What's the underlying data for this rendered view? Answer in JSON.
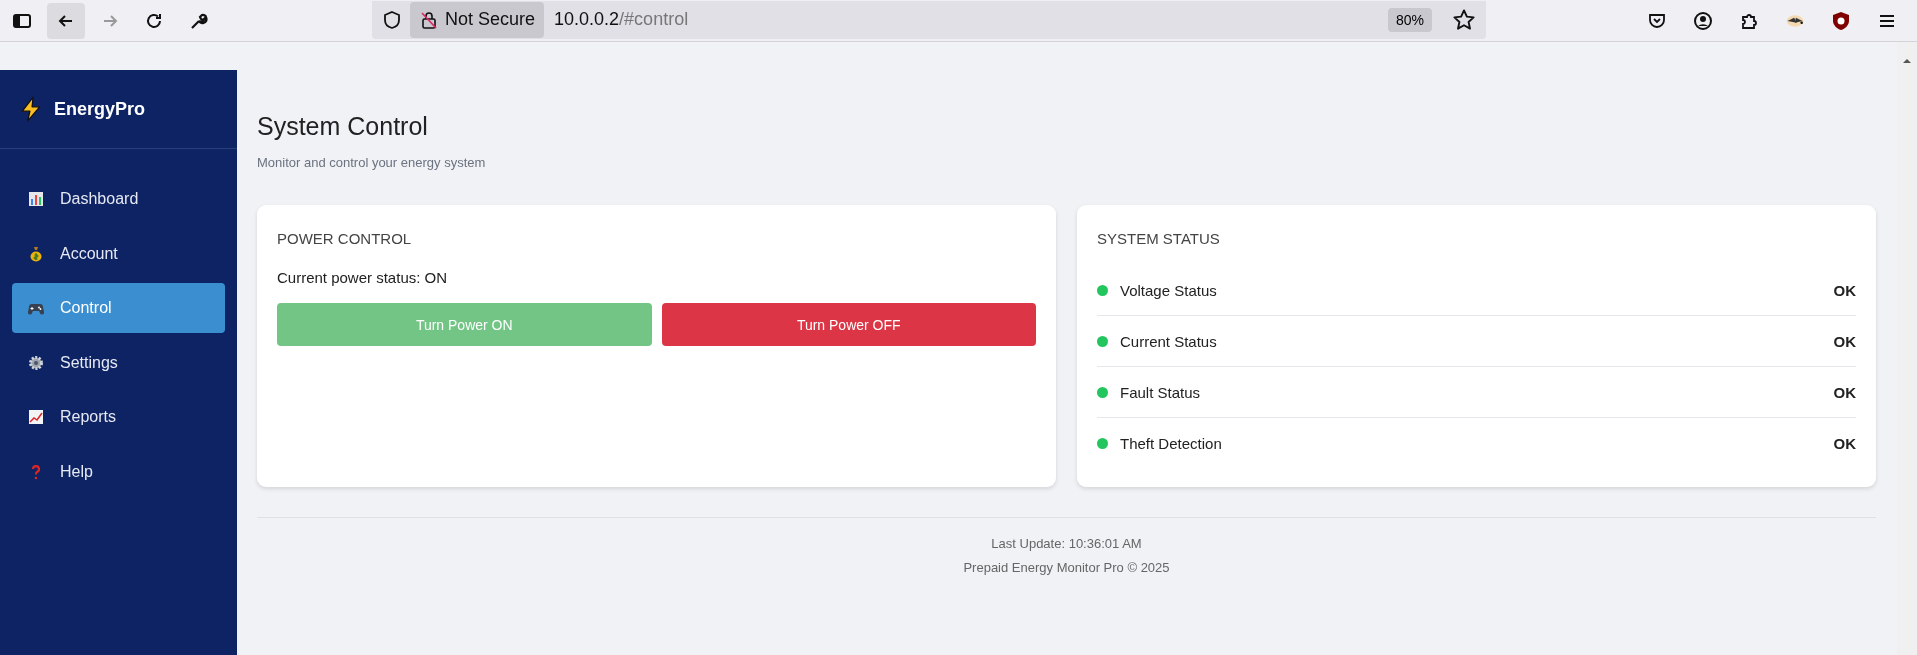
{
  "browser": {
    "security": "Not Secure",
    "url_host": "10.0.0.2",
    "url_path": "/#control",
    "zoom": "80%"
  },
  "sidebar": {
    "brand": "EnergyPro",
    "items": [
      {
        "label": "Dashboard",
        "kind": "chart",
        "selected": false
      },
      {
        "label": "Account",
        "kind": "money",
        "selected": false
      },
      {
        "label": "Control",
        "kind": "gamepad",
        "selected": true
      },
      {
        "label": "Settings",
        "kind": "gear",
        "selected": false
      },
      {
        "label": "Reports",
        "kind": "trend",
        "selected": false
      },
      {
        "label": "Help",
        "kind": "question",
        "selected": false
      }
    ]
  },
  "page": {
    "title": "System Control",
    "subtitle": "Monitor and control your energy system"
  },
  "power_control": {
    "heading": "POWER CONTROL",
    "status_text": "Current power status: ON",
    "buttons": [
      {
        "label": "Turn Power ON",
        "kind": "on",
        "disabled": true
      },
      {
        "label": "Turn Power OFF",
        "kind": "off",
        "disabled": false
      }
    ]
  },
  "system_status": {
    "heading": "SYSTEM STATUS",
    "items": [
      {
        "label": "Voltage Status",
        "value": "OK",
        "color": "#22c55e"
      },
      {
        "label": "Current Status",
        "value": "OK",
        "color": "#22c55e"
      },
      {
        "label": "Fault Status",
        "value": "OK",
        "color": "#22c55e"
      },
      {
        "label": "Theft Detection",
        "value": "OK",
        "color": "#22c55e"
      }
    ]
  },
  "footer": {
    "last_update": "Last Update: 10:36:01 AM",
    "copyright": "Prepaid Energy Monitor Pro © 2025"
  }
}
